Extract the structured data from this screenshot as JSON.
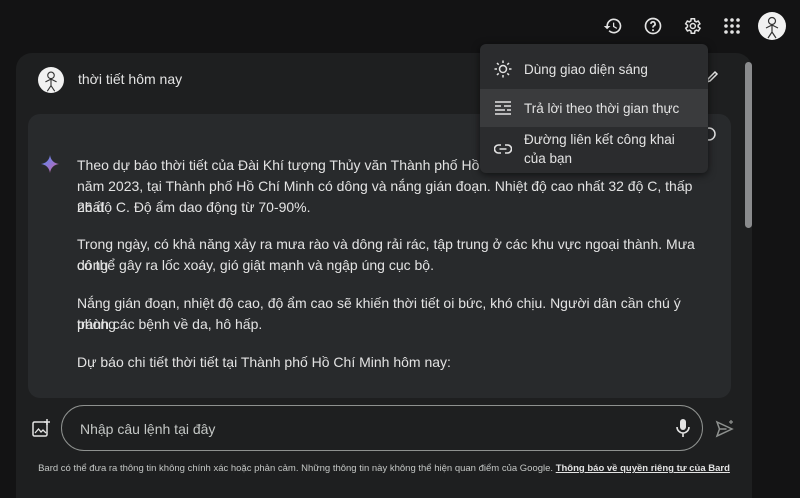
{
  "topbar": {
    "icons": [
      "history-icon",
      "help-icon",
      "settings-icon",
      "apps-grid-icon"
    ]
  },
  "conversation": {
    "user_query": "thời tiết hôm nay",
    "response_paragraphs": [
      "Theo dự báo thời tiết của Đài Khí tượng Thủy văn Thành phố Hồ Chí Minh, hôm nay, ngày 20 tháng 11 năm 2023, tại Thành phố Hồ Chí Minh có dông và nắng gián đoạn. Nhiệt độ cao nhất 32 độ C, thấp nhất 26 độ C. Độ ẩm dao động từ 70-90%.",
      "Trong ngày, có khả năng xảy ra mưa rào và dông rải rác, tập trung ở các khu vực ngoại thành. Mưa dông có thể gây ra lốc xoáy, gió giật mạnh và ngập úng cục bộ.",
      "Nắng gián đoạn, nhiệt độ cao, độ ẩm cao sẽ khiến thời tiết oi bức, khó chịu. Người dân cần chú ý phòng tránh các bệnh về da, hô hấp.",
      "Dự báo chi tiết thời tiết tại Thành phố Hồ Chí Minh hôm nay:"
    ],
    "visible_lines": {
      "p1_l1": "Theo dự báo thời tiết của Đài Khí tượng Thủy văn Thành phố Hồ Chí",
      "p1_l2": "năm 2023, tại Thành phố Hồ Chí Minh có dông và nắng gián đoạn. Nhiệt độ cao nhất 32 độ C, thấp nhất",
      "p1_l3": "26 độ C. Độ ẩm dao động từ 70-90%.",
      "p2_l1": "Trong ngày, có khả năng xảy ra mưa rào và dông rải rác, tập trung ở các khu vực ngoại thành. Mưa dông",
      "p2_l2": "có thể gây ra lốc xoáy, gió giật mạnh và ngập úng cục bộ.",
      "p3_l1": "Nắng gián đoạn, nhiệt độ cao, độ ẩm cao sẽ khiến thời tiết oi bức, khó chịu. Người dân cần chú ý phòng",
      "p3_l2": "tránh các bệnh về da, hô hấp.",
      "p4_l1": "Dự báo chi tiết thời tiết tại Thành phố Hồ Chí Minh hôm nay:"
    }
  },
  "settings_menu": {
    "items": [
      {
        "label": "Dùng giao diện sáng",
        "icon": "sun-icon"
      },
      {
        "label": "Trả lời theo thời gian thực",
        "icon": "realtime-lines-icon"
      },
      {
        "label": "Đường liên kết công khai của bạn",
        "icon": "link-icon"
      }
    ]
  },
  "input": {
    "placeholder": "Nhập câu lệnh tại đây"
  },
  "footer": {
    "disclaimer": "Bard có thể đưa ra thông tin không chính xác hoặc phản cảm. Những thông tin này không thể hiện quan điểm của Google.",
    "privacy_link": "Thông báo về quyền riêng tư của Bard"
  },
  "colors": {
    "background": "#131314",
    "panel": "#1e1f20",
    "card": "#282a2c",
    "menu": "#2b2c2e",
    "text": "#e3e3e3"
  }
}
